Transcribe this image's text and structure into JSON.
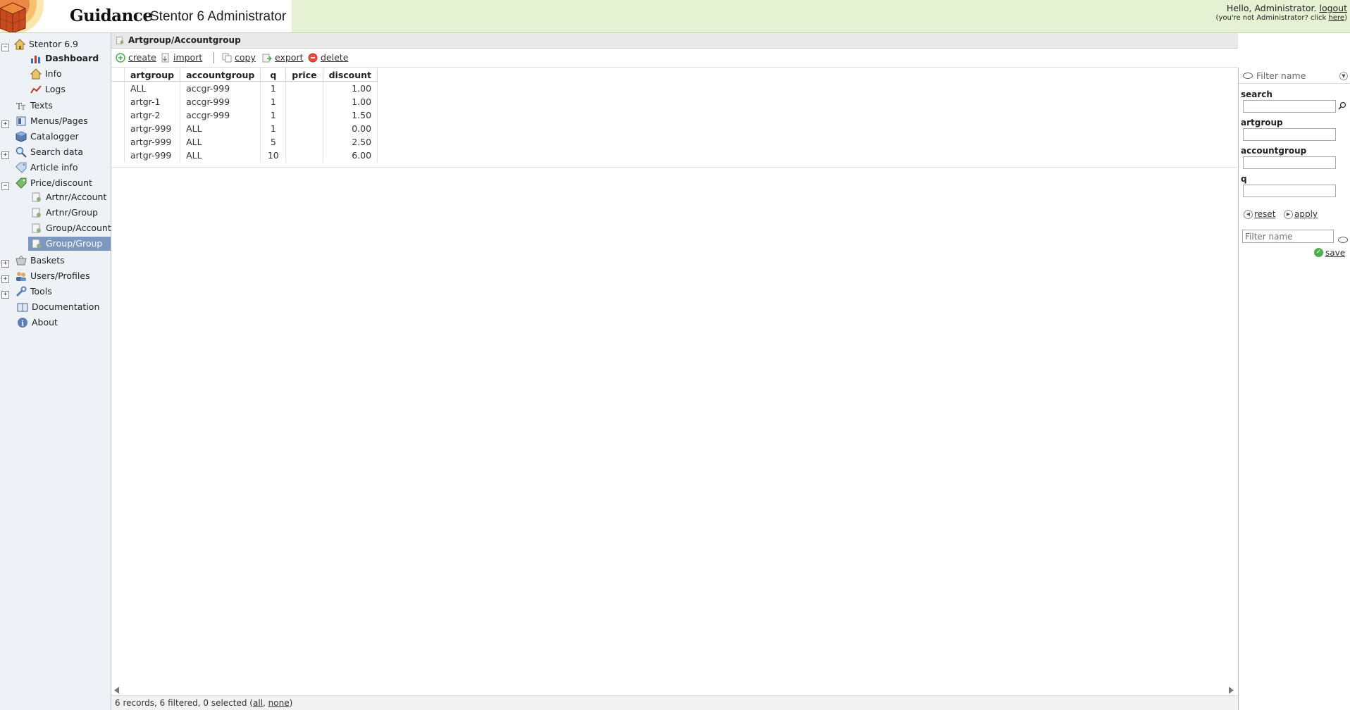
{
  "header": {
    "brand": "Guidance",
    "app_title": "Stentor 6 Administrator",
    "greeting": "Hello, Administrator.",
    "logout_label": "logout",
    "not_admin_prefix": "(you're not Administrator? click",
    "here_label": "here",
    "not_admin_suffix": ")"
  },
  "sidebar": {
    "root_label": "Stentor 6.9",
    "items": [
      {
        "label": "Dashboard",
        "icon": "chart-icon"
      },
      {
        "label": "Info",
        "icon": "house-icon"
      },
      {
        "label": "Logs",
        "icon": "line-chart-icon"
      },
      {
        "label": "Texts",
        "icon": "text-icon"
      },
      {
        "label": "Menus/Pages",
        "icon": "pages-icon"
      },
      {
        "label": "Catalogger",
        "icon": "cube-icon"
      },
      {
        "label": "Search data",
        "icon": "magnifier-icon"
      },
      {
        "label": "Article info",
        "icon": "tag-icon"
      },
      {
        "label": "Price/discount",
        "icon": "price-tag-icon"
      },
      {
        "label": "Artnr/Account",
        "icon": "doc-icon"
      },
      {
        "label": "Artnr/Group",
        "icon": "doc-icon"
      },
      {
        "label": "Group/Account",
        "icon": "doc-icon"
      },
      {
        "label": "Group/Group",
        "icon": "doc-icon"
      },
      {
        "label": "Baskets",
        "icon": "basket-icon"
      },
      {
        "label": "Users/Profiles",
        "icon": "users-icon"
      },
      {
        "label": "Tools",
        "icon": "wrench-icon"
      },
      {
        "label": "Documentation",
        "icon": "book-icon"
      },
      {
        "label": "About",
        "icon": "info-icon"
      }
    ]
  },
  "main": {
    "title": "Artgroup/Accountgroup",
    "toolbar": {
      "create": "create",
      "import": "import",
      "copy": "copy",
      "export": "export",
      "delete": "delete"
    },
    "columns": [
      "artgroup",
      "accountgroup",
      "q",
      "price",
      "discount"
    ],
    "rows": [
      {
        "artgroup": "ALL",
        "accountgroup": "accgr-999",
        "q": "1",
        "price": "",
        "discount": "1.00"
      },
      {
        "artgroup": "artgr-1",
        "accountgroup": "accgr-999",
        "q": "1",
        "price": "",
        "discount": "1.00"
      },
      {
        "artgroup": "artgr-2",
        "accountgroup": "accgr-999",
        "q": "1",
        "price": "",
        "discount": "1.50"
      },
      {
        "artgroup": "artgr-999",
        "accountgroup": "ALL",
        "q": "1",
        "price": "",
        "discount": "0.00"
      },
      {
        "artgroup": "artgr-999",
        "accountgroup": "ALL",
        "q": "5",
        "price": "",
        "discount": "2.50"
      },
      {
        "artgroup": "artgr-999",
        "accountgroup": "ALL",
        "q": "10",
        "price": "",
        "discount": "6.00"
      }
    ],
    "status": {
      "summary": "6 records, 6 filtered, 0 selected (",
      "all_label": "all",
      "separator": ", ",
      "none_label": "none",
      "suffix": ")"
    }
  },
  "filter_panel": {
    "header_name": "Filter name",
    "search_label": "search",
    "artgroup_label": "artgroup",
    "accountgroup_label": "accountgroup",
    "q_label": "q",
    "search_value": "",
    "artgroup_value": "",
    "accountgroup_value": "",
    "q_value": "",
    "reset_label": "reset",
    "apply_label": "apply",
    "filter_name_placeholder": "Filter name",
    "save_label": "save"
  },
  "colors": {
    "header_green": "#e6f0d2",
    "sidebar_bg": "#eef2f6",
    "selected_bg": "#7c98bf"
  }
}
